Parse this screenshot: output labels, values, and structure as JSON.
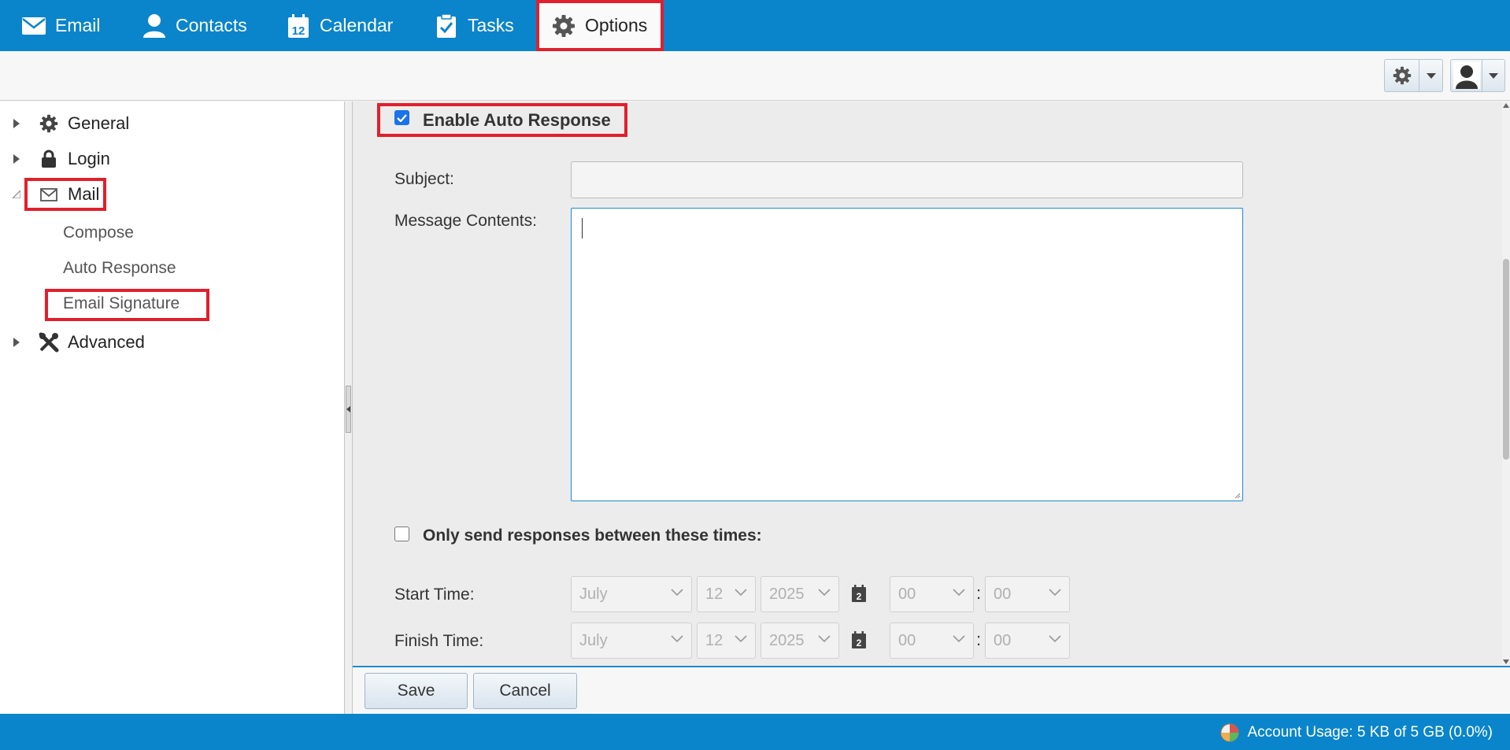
{
  "nav": {
    "tabs": [
      {
        "label": "Email",
        "icon": "envelope-icon"
      },
      {
        "label": "Contacts",
        "icon": "person-icon"
      },
      {
        "label": "Calendar",
        "icon": "calendar-icon",
        "icon_text": "12"
      },
      {
        "label": "Tasks",
        "icon": "clipboard-check-icon"
      },
      {
        "label": "Options",
        "icon": "gear-icon",
        "active": true
      }
    ]
  },
  "toolbar": {
    "settings_menu": {
      "icon": "gear-icon"
    },
    "user_menu": {
      "icon": "user-avatar-icon"
    }
  },
  "sidebar": {
    "items": [
      {
        "label": "General",
        "icon": "gear-icon",
        "expanded": false
      },
      {
        "label": "Login",
        "icon": "lock-icon",
        "expanded": false
      },
      {
        "label": "Mail",
        "icon": "envelope-icon",
        "expanded": true,
        "children": [
          {
            "label": "Compose"
          },
          {
            "label": "Auto Response"
          },
          {
            "label": "Email Signature"
          }
        ]
      },
      {
        "label": "Advanced",
        "icon": "tools-icon",
        "expanded": false
      }
    ]
  },
  "form": {
    "enable_label": "Enable Auto Response",
    "enable_checked": true,
    "subject_label": "Subject:",
    "subject_value": "",
    "message_label": "Message Contents:",
    "message_value": "",
    "times_label": "Only send responses between these times:",
    "times_checked": false,
    "start_label": "Start Time:",
    "finish_label": "Finish Time:",
    "start": {
      "month": "July",
      "day": "12",
      "year": "2025",
      "hour": "00",
      "minute": "00",
      "calendar_icon_text": "2"
    },
    "finish": {
      "month": "July",
      "day": "12",
      "year": "2025",
      "hour": "00",
      "minute": "00",
      "calendar_icon_text": "2"
    },
    "time_separator": ":"
  },
  "actions": {
    "save": "Save",
    "cancel": "Cancel"
  },
  "status": {
    "usage_text": "Account Usage: 5 KB of 5 GB (0.0%)"
  },
  "colors": {
    "brand_blue": "#0a85cb",
    "highlight_red": "#e0202c",
    "focus_blue": "#1c8bd2"
  }
}
